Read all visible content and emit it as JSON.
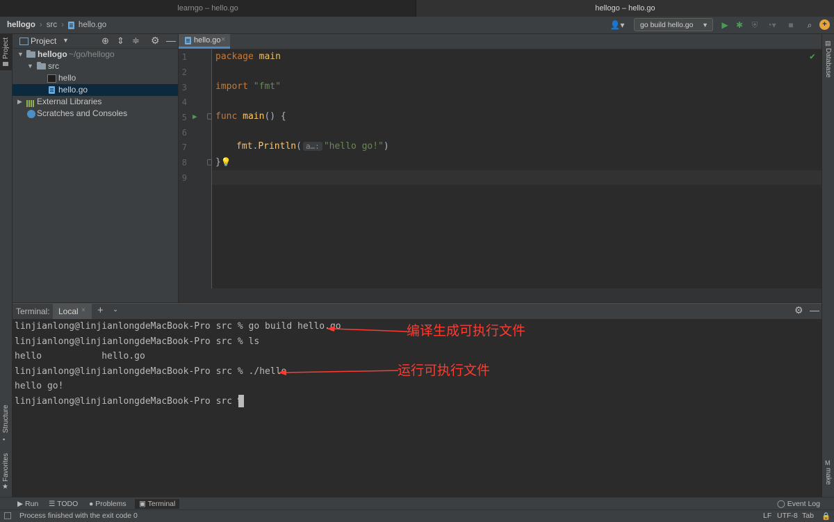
{
  "window_tabs": [
    "learngo – hello.go",
    "hellogo – hello.go"
  ],
  "breadcrumbs": [
    "hellogo",
    "src",
    "hello.go"
  ],
  "run_config": "go build hello.go",
  "left_tools": [
    "Project",
    "Structure",
    "Favorites"
  ],
  "right_tools": [
    "Database",
    "make"
  ],
  "project": {
    "title": "Project",
    "tree": [
      {
        "label": "hellogo",
        "path": "~/go/hellogo",
        "icon": "folder-icon"
      },
      {
        "label": "src",
        "icon": "folder-icon"
      },
      {
        "label": "hello",
        "icon": "executable-icon"
      },
      {
        "label": "hello.go",
        "icon": "go-file-icon",
        "selected": true
      },
      {
        "label": "External Libraries",
        "icon": "library-icon"
      },
      {
        "label": "Scratches and Consoles",
        "icon": "scratch-icon"
      }
    ]
  },
  "editor": {
    "tab": "hello.go",
    "line_numbers": [
      "1",
      "2",
      "3",
      "4",
      "5",
      "6",
      "7",
      "8",
      "9"
    ],
    "code": {
      "l1_kw": "package",
      "l1_name": "main",
      "l3_kw": "import",
      "l3_str": "\"fmt\"",
      "l5_kw": "func",
      "l5_fn": "main",
      "l5_rest": "() {",
      "l7_pkg": "fmt",
      "l7_dot": ".",
      "l7_fn": "Println",
      "l7_open": "(",
      "l7_hint": "a…:",
      "l7_str": "\"hello go!\"",
      "l7_close": ")",
      "l8": "}"
    }
  },
  "terminal": {
    "label": "Terminal:",
    "tab": "Local",
    "lines": [
      "linjianlong@linjianlongdeMacBook-Pro src % go build hello.go",
      "linjianlong@linjianlongdeMacBook-Pro src % ls",
      "hello           hello.go",
      "linjianlong@linjianlongdeMacBook-Pro src % ./hello",
      "hello go!",
      "linjianlong@linjianlongdeMacBook-Pro src % "
    ],
    "annotations": [
      "编译生成可执行文件",
      "运行可执行文件"
    ],
    "annotation_color": "#ff3b30"
  },
  "bottom_tools": [
    "Run",
    "TODO",
    "Problems",
    "Terminal"
  ],
  "event_log": "Event Log",
  "status": {
    "message": "Process finished with the exit code 0",
    "line_sep": "LF",
    "encoding": "UTF-8",
    "indent": "Tab"
  },
  "colors": {
    "keyword": "#cc7832",
    "string": "#6a8759",
    "function": "#ffc66d",
    "run_green": "#499c54",
    "selection": "#0d293e"
  }
}
